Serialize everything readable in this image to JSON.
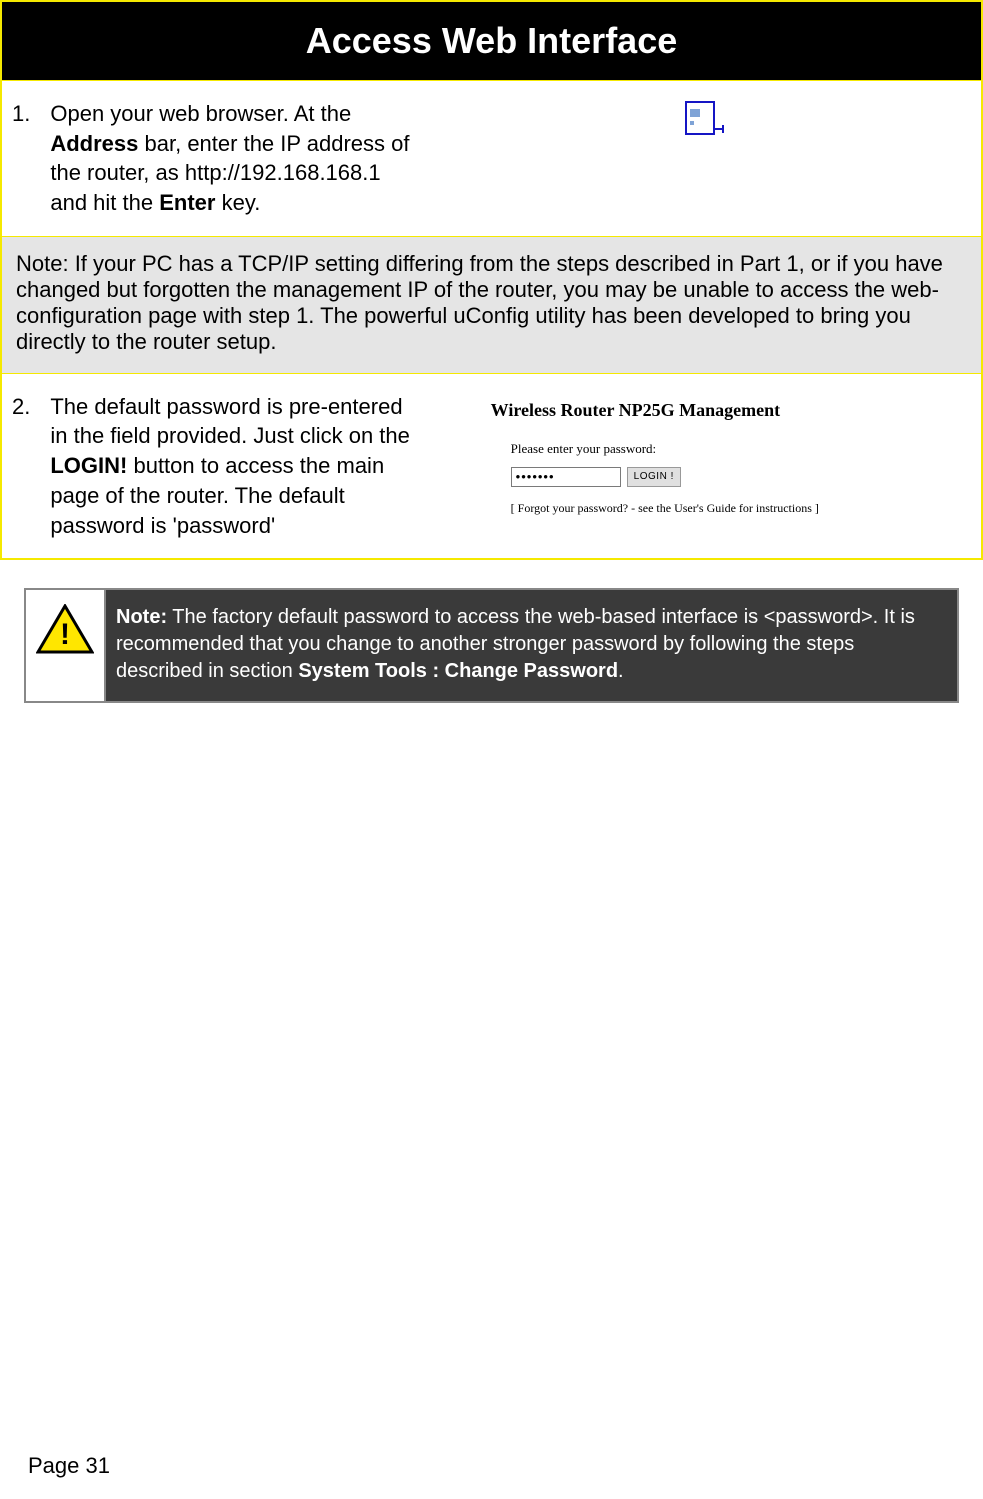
{
  "title": "Access Web Interface",
  "step1": {
    "number": "1.",
    "pre": "Open your web browser. At the ",
    "bold1": "Address",
    "mid": " bar, enter the IP address of the router, as http://192.168.168.1 and hit the ",
    "bold2": "Enter",
    "post": " key."
  },
  "note1": "Note: If your PC has a TCP/IP setting differing from the steps described in Part 1, or if you have changed but forgotten the management IP of the router, you may be unable to access the web-configuration page with step 1. The powerful uConfig utility has been developed to bring you directly to the router setup.",
  "step2": {
    "number": "2.",
    "pre": "The default password is pre-entered in the field provided. Just click on the ",
    "bold1": "LOGIN!",
    "post": " button to access the main page of the router.   The default password is 'password'"
  },
  "login": {
    "title": "Wireless Router NP25G Management",
    "prompt": "Please enter your password:",
    "value": "•••••••",
    "button": "LOGIN !",
    "forgot": "[ Forgot your password? - see the User's Guide for instructions ]"
  },
  "warning": {
    "bold1": "Note:",
    "text1": " The factory default password to access the web-based interface is <password>. It is recommended that you change to another stronger password by following the steps described in section ",
    "bold2": "System Tools : Change Password",
    "text2": "."
  },
  "pageNumber": "Page 31"
}
